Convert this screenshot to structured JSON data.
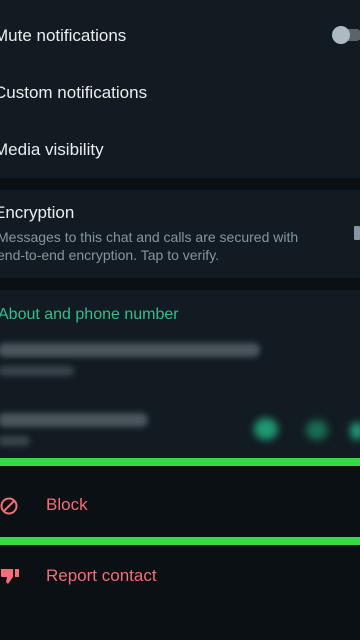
{
  "settings": {
    "mute_label": "Mute notifications",
    "custom_label": "Custom notifications",
    "media_label": "Media visibility"
  },
  "encryption": {
    "title": "Encryption",
    "description": "Messages to this chat and calls are secured with end-to-end encryption. Tap to verify."
  },
  "about": {
    "header": "About and phone number"
  },
  "actions": {
    "block_label": "Block",
    "report_label": "Report contact"
  },
  "colors": {
    "accent_green": "#2fbf8d",
    "danger_red": "#f06f78",
    "highlight_green": "#37d94a"
  }
}
